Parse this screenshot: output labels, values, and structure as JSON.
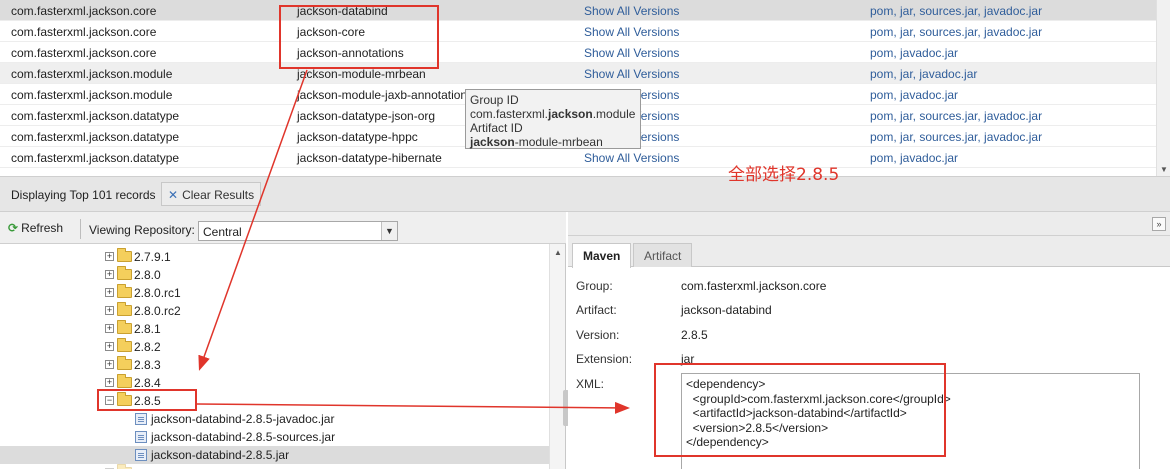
{
  "results": {
    "rows": [
      {
        "group": "com.fasterxml.jackson.core",
        "artifact": "jackson-databind",
        "versions_link": "Show All Versions",
        "files": "pom, jar, sources.jar, javadoc.jar"
      },
      {
        "group": "com.fasterxml.jackson.core",
        "artifact": "jackson-core",
        "versions_link": "Show All Versions",
        "files": "pom, jar, sources.jar, javadoc.jar"
      },
      {
        "group": "com.fasterxml.jackson.core",
        "artifact": "jackson-annotations",
        "versions_link": "Show All Versions",
        "files": "pom, javadoc.jar"
      },
      {
        "group": "com.fasterxml.jackson.module",
        "artifact": "jackson-module-mrbean",
        "versions_link": "Show All Versions",
        "files": "pom, jar, javadoc.jar"
      },
      {
        "group": "com.fasterxml.jackson.module",
        "artifact": "jackson-module-jaxb-annotations",
        "versions_link": "Show All Versions",
        "files": "pom, javadoc.jar"
      },
      {
        "group": "com.fasterxml.jackson.datatype",
        "artifact": "jackson-datatype-json-org",
        "versions_link": "Show All Versions",
        "files": "pom, jar, sources.jar, javadoc.jar"
      },
      {
        "group": "com.fasterxml.jackson.datatype",
        "artifact": "jackson-datatype-hppc",
        "versions_link": "Show All Versions",
        "files": "pom, jar, sources.jar, javadoc.jar"
      },
      {
        "group": "com.fasterxml.jackson.datatype",
        "artifact": "jackson-datatype-hibernate",
        "versions_link": "Show All Versions",
        "files": "pom, javadoc.jar"
      }
    ]
  },
  "tooltip": {
    "group_label": "Group ID",
    "group_prefix": "com.fasterxml.",
    "group_bold": "jackson",
    "group_suffix": ".module",
    "artifact_label": "Artifact ID",
    "artifact_bold": "jackson",
    "artifact_suffix": "-module-mrbean"
  },
  "status": {
    "records": "Displaying Top 101 records",
    "clear_label": "Clear Results"
  },
  "annotation": {
    "text": "全部选择2.8.5"
  },
  "left_toolbar": {
    "refresh_label": "Refresh",
    "repo_label": "Viewing Repository:",
    "repo_value": "Central"
  },
  "tree": {
    "folders": [
      "2.7.9.1",
      "2.8.0",
      "2.8.0.rc1",
      "2.8.0.rc2",
      "2.8.1",
      "2.8.2",
      "2.8.3",
      "2.8.4",
      "2.8.5"
    ],
    "files": [
      "jackson-databind-2.8.5-javadoc.jar",
      "jackson-databind-2.8.5-sources.jar",
      "jackson-databind-2.8.5.jar"
    ]
  },
  "right_panel": {
    "tabs": [
      "Maven",
      "Artifact"
    ],
    "props": [
      {
        "label": "Group:",
        "value": "com.fasterxml.jackson.core"
      },
      {
        "label": "Artifact:",
        "value": "jackson-databind"
      },
      {
        "label": "Version:",
        "value": "2.8.5"
      },
      {
        "label": "Extension:",
        "value": "jar"
      },
      {
        "label": "XML:",
        "value": ""
      }
    ],
    "xml": "<dependency>\n  <groupId>com.fasterxml.jackson.core</groupId>\n  <artifactId>jackson-databind</artifactId>\n  <version>2.8.5</version>\n</dependency>"
  },
  "colors": {
    "annotation_red": "#e0352b",
    "link_blue": "#2f5d9a"
  }
}
